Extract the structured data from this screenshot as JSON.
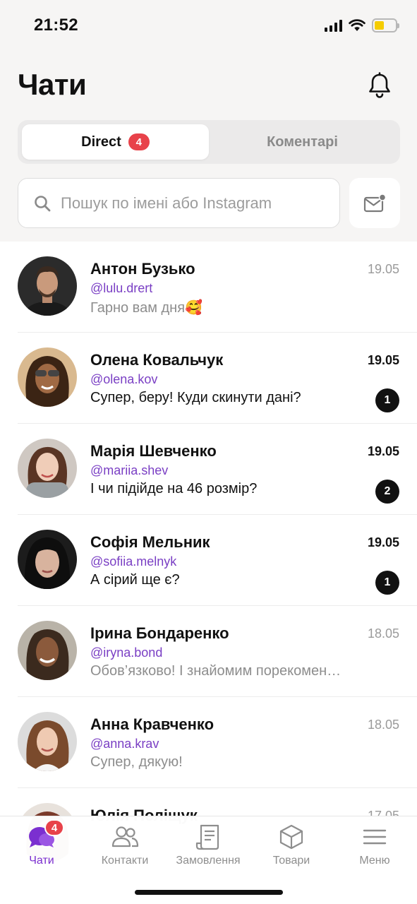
{
  "status_bar": {
    "time": "21:52"
  },
  "header": {
    "title": "Чати"
  },
  "tabs": [
    {
      "label": "Direct",
      "badge": "4",
      "active": true
    },
    {
      "label": "Коментарі",
      "active": false
    }
  ],
  "search": {
    "placeholder": "Пошук по імені або Instagram",
    "value": ""
  },
  "chats": [
    {
      "name": "Антон Бузько",
      "handle": "@lulu.drert",
      "preview": "Гарно вам дня🥰",
      "date": "19.05",
      "unread": ""
    },
    {
      "name": "Олена Ковальчук",
      "handle": "@olena.kov",
      "preview": "Супер, беру! Куди скинути дані?",
      "date": "19.05",
      "unread": "1"
    },
    {
      "name": "Марія Шевченко",
      "handle": "@mariia.shev",
      "preview": "І чи підійде на 46 розмір?",
      "date": "19.05",
      "unread": "2"
    },
    {
      "name": "Софія Мельник",
      "handle": "@sofiia.melnyk",
      "preview": "А сірий ще є?",
      "date": "19.05",
      "unread": "1"
    },
    {
      "name": "Ірина Бондаренко",
      "handle": "@iryna.bond",
      "preview": "Обов’язково! І знайомим порекомендую",
      "date": "18.05",
      "unread": ""
    },
    {
      "name": "Анна Кравченко",
      "handle": "@anna.krav",
      "preview": "Супер, дякую!",
      "date": "18.05",
      "unread": ""
    },
    {
      "name": "Юлія Поліщук",
      "handle": "",
      "preview": "",
      "date": "17.05",
      "unread": ""
    }
  ],
  "tab_bar": [
    {
      "label": "Чати",
      "icon": "chat-bubbles-icon",
      "badge": "4",
      "active": true
    },
    {
      "label": "Контакти",
      "icon": "contacts-icon"
    },
    {
      "label": "Замовлення",
      "icon": "receipt-icon"
    },
    {
      "label": "Товари",
      "icon": "box-icon"
    },
    {
      "label": "Меню",
      "icon": "menu-icon"
    }
  ],
  "colors": {
    "accent": "#7b2fd0",
    "badge_red": "#e8424a",
    "handle": "#7a3fc4"
  }
}
